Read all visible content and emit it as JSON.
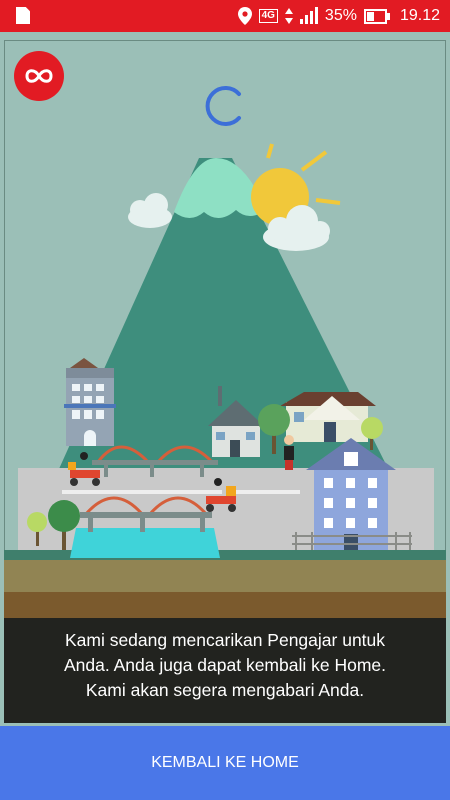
{
  "status_bar": {
    "network_type": "4G",
    "battery_percent": "35%",
    "time": "19.12",
    "icons": [
      "sim-card-icon",
      "location-icon",
      "network-4g-icon",
      "signal-icon",
      "battery-icon"
    ]
  },
  "app": {
    "logo_icon": "infinity-icon",
    "brand_color": "#e21b23"
  },
  "loading": {
    "spinner_color": "#3c6fd8"
  },
  "message": {
    "text": "Kami sedang mencarikan Pengajar untuk\nAnda. Anda juga dapat kembali ke Home.\nKami akan segera mengabari Anda."
  },
  "home_button": {
    "label": "KEMBALI KE HOME",
    "color": "#4a77e8"
  }
}
